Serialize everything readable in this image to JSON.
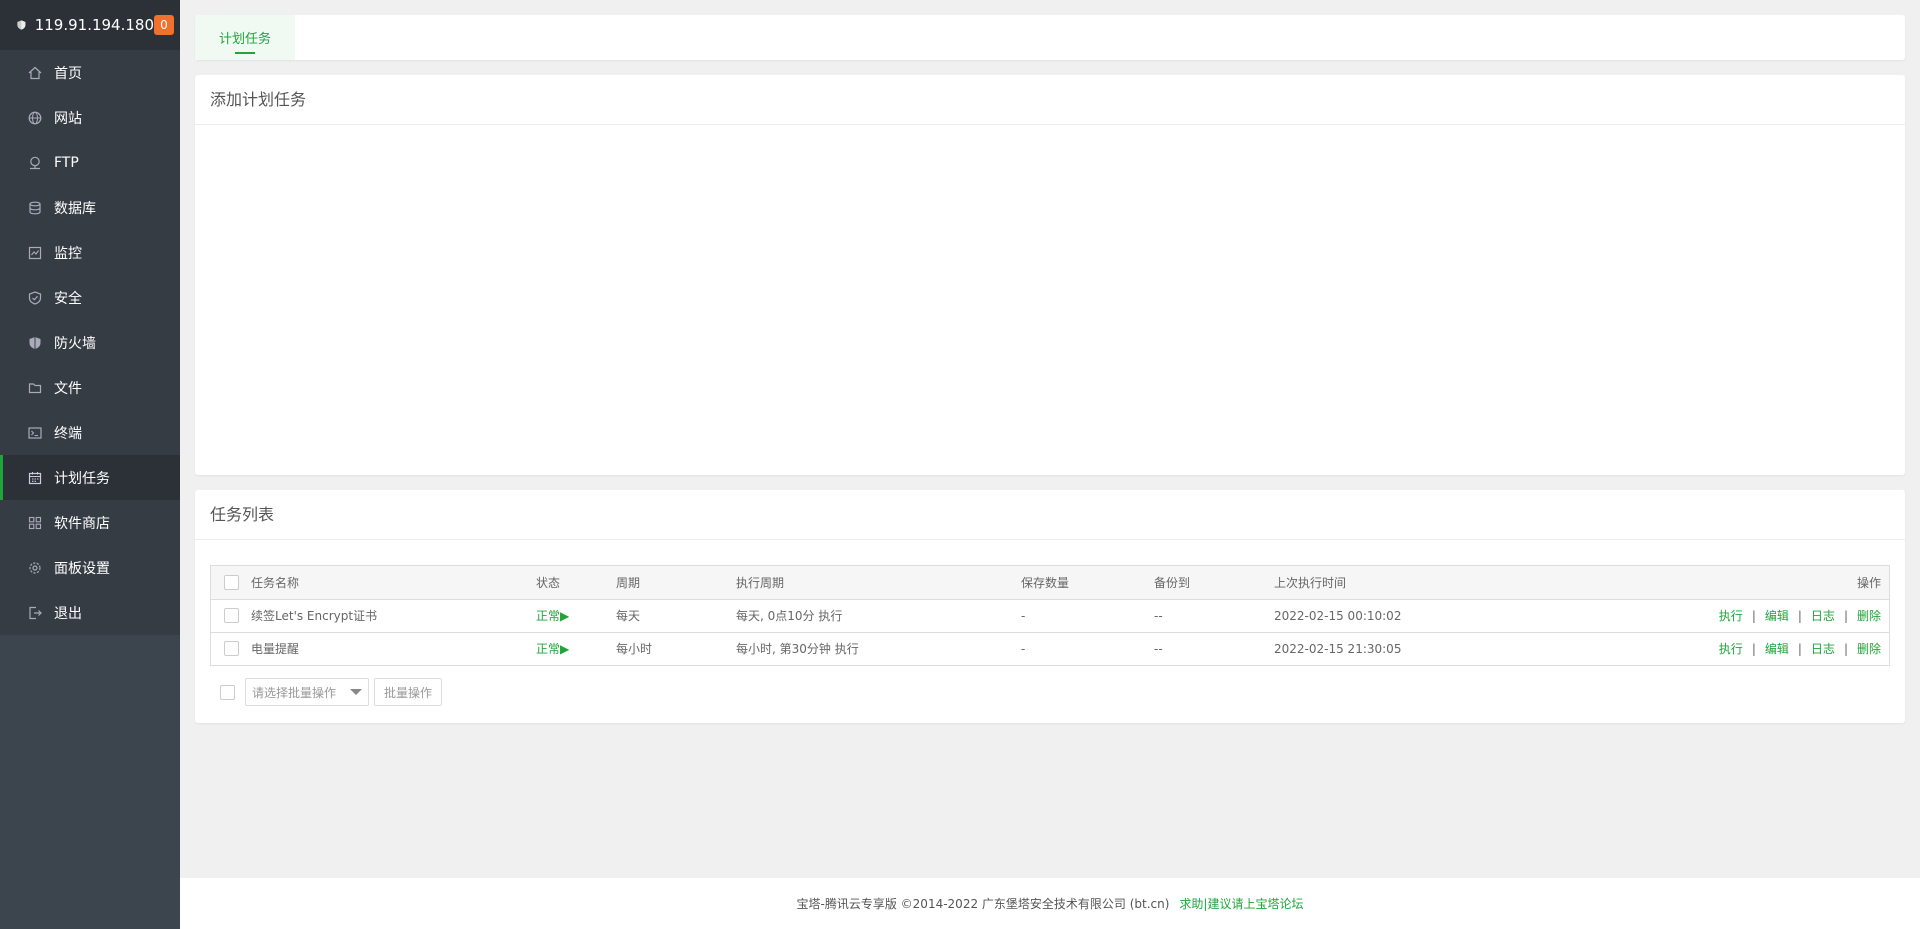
{
  "sidebar": {
    "ip": "119.91.194.180",
    "badge": "0",
    "items": [
      {
        "label": "首页",
        "icon": "home-icon"
      },
      {
        "label": "网站",
        "icon": "globe-icon"
      },
      {
        "label": "FTP",
        "icon": "ftp-icon"
      },
      {
        "label": "数据库",
        "icon": "database-icon"
      },
      {
        "label": "监控",
        "icon": "monitor-icon"
      },
      {
        "label": "安全",
        "icon": "shield-check-icon"
      },
      {
        "label": "防火墙",
        "icon": "firewall-icon"
      },
      {
        "label": "文件",
        "icon": "folder-icon"
      },
      {
        "label": "终端",
        "icon": "terminal-icon"
      },
      {
        "label": "计划任务",
        "icon": "calendar-icon",
        "active": true
      },
      {
        "label": "软件商店",
        "icon": "apps-icon"
      },
      {
        "label": "面板设置",
        "icon": "gear-icon"
      },
      {
        "label": "退出",
        "icon": "logout-icon"
      }
    ]
  },
  "tabs": {
    "active": "计划任务"
  },
  "add_card": {
    "title": "添加计划任务"
  },
  "list_card": {
    "title": "任务列表",
    "columns": [
      "任务名称",
      "状态",
      "周期",
      "执行周期",
      "保存数量",
      "备份到",
      "上次执行时间",
      "操作"
    ],
    "rows": [
      {
        "name": "续签Let's Encrypt证书",
        "status": "正常▶",
        "period": "每天",
        "exec": "每天, 0点10分 执行",
        "save": "-",
        "backup": "--",
        "last": "2022-02-15 00:10:02"
      },
      {
        "name": "电量提醒",
        "status": "正常▶",
        "period": "每小时",
        "exec": "每小时, 第30分钟 执行",
        "save": "-",
        "backup": "--",
        "last": "2022-02-15 21:30:05"
      }
    ],
    "ops": {
      "run": "执行",
      "edit": "编辑",
      "log": "日志",
      "delete": "删除",
      "sep": "|"
    },
    "batch_placeholder": "请选择批量操作",
    "batch_button": "批量操作"
  },
  "footer": {
    "text": "宝塔-腾讯云专享版 ©2014-2022 广东堡塔安全技术有限公司 (bt.cn)",
    "link": "求助|建议请上宝塔论坛"
  },
  "colors": {
    "accent": "#20a53a",
    "sidebar_bg": "#3c444d",
    "badge": "#f0702e"
  }
}
